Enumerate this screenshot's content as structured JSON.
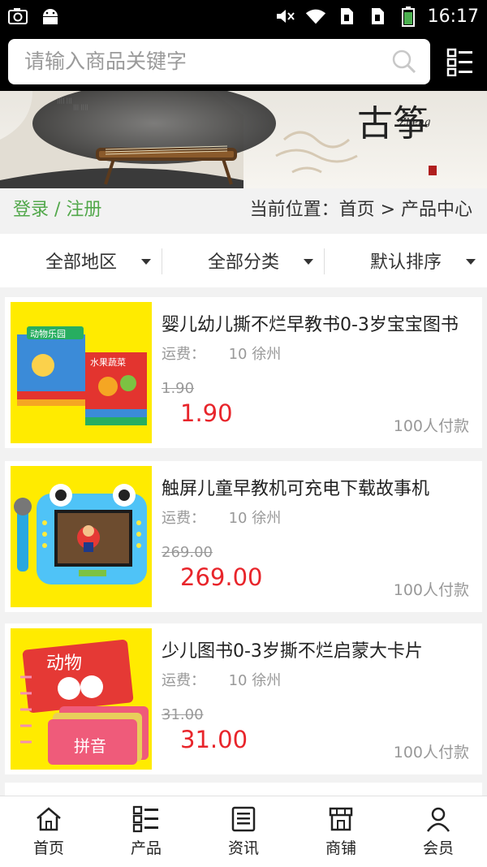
{
  "status_bar": {
    "time": "16:17",
    "left_icons": [
      "camera-icon",
      "android-icon"
    ],
    "right_icons": [
      "mute-icon",
      "wifi-icon",
      "sim1-icon",
      "sim2-icon",
      "battery-icon"
    ]
  },
  "header": {
    "search_placeholder": "请输入商品关键字",
    "search_icon": "search-icon",
    "menu_icon": "category-menu-icon"
  },
  "banner": {
    "calligraphy": "古筝",
    "latin": "Zheng"
  },
  "breadcrumb_bar": {
    "login": "登录 / 注册",
    "location": "当前位置：首页 > 产品中心"
  },
  "filters": [
    {
      "label": "全部地区"
    },
    {
      "label": "全部分类"
    },
    {
      "label": "默认排序"
    }
  ],
  "products": [
    {
      "title": "婴儿幼儿撕不烂早教书0-3岁宝宝图书",
      "shipping_label": "运费：",
      "shipping_value": "10",
      "city": "徐州",
      "original_price": "1.90",
      "price": "1.90",
      "sold": "100人付款",
      "image_text_1": "动物乐园",
      "image_text_2": "水果蔬菜"
    },
    {
      "title": "触屏儿童早教机可充电下载故事机",
      "shipping_label": "运费：",
      "shipping_value": "10",
      "city": "徐州",
      "original_price": "269.00",
      "price": "269.00",
      "sold": "100人付款"
    },
    {
      "title": "少儿图书0-3岁撕不烂启蒙大卡片",
      "shipping_label": "运费：",
      "shipping_value": "10",
      "city": "徐州",
      "original_price": "31.00",
      "price": "31.00",
      "sold": "100人付款",
      "image_text_1": "动物",
      "image_text_2": "拼音"
    }
  ],
  "tabbar": [
    {
      "label": "首页",
      "icon": "home-icon"
    },
    {
      "label": "产品",
      "icon": "product-list-icon"
    },
    {
      "label": "资讯",
      "icon": "news-icon"
    },
    {
      "label": "商铺",
      "icon": "shop-icon"
    },
    {
      "label": "会员",
      "icon": "member-icon"
    }
  ],
  "colors": {
    "accent_green": "#52a84b",
    "price_red": "#e8252b",
    "thumb_yellow": "#ffeb00"
  }
}
